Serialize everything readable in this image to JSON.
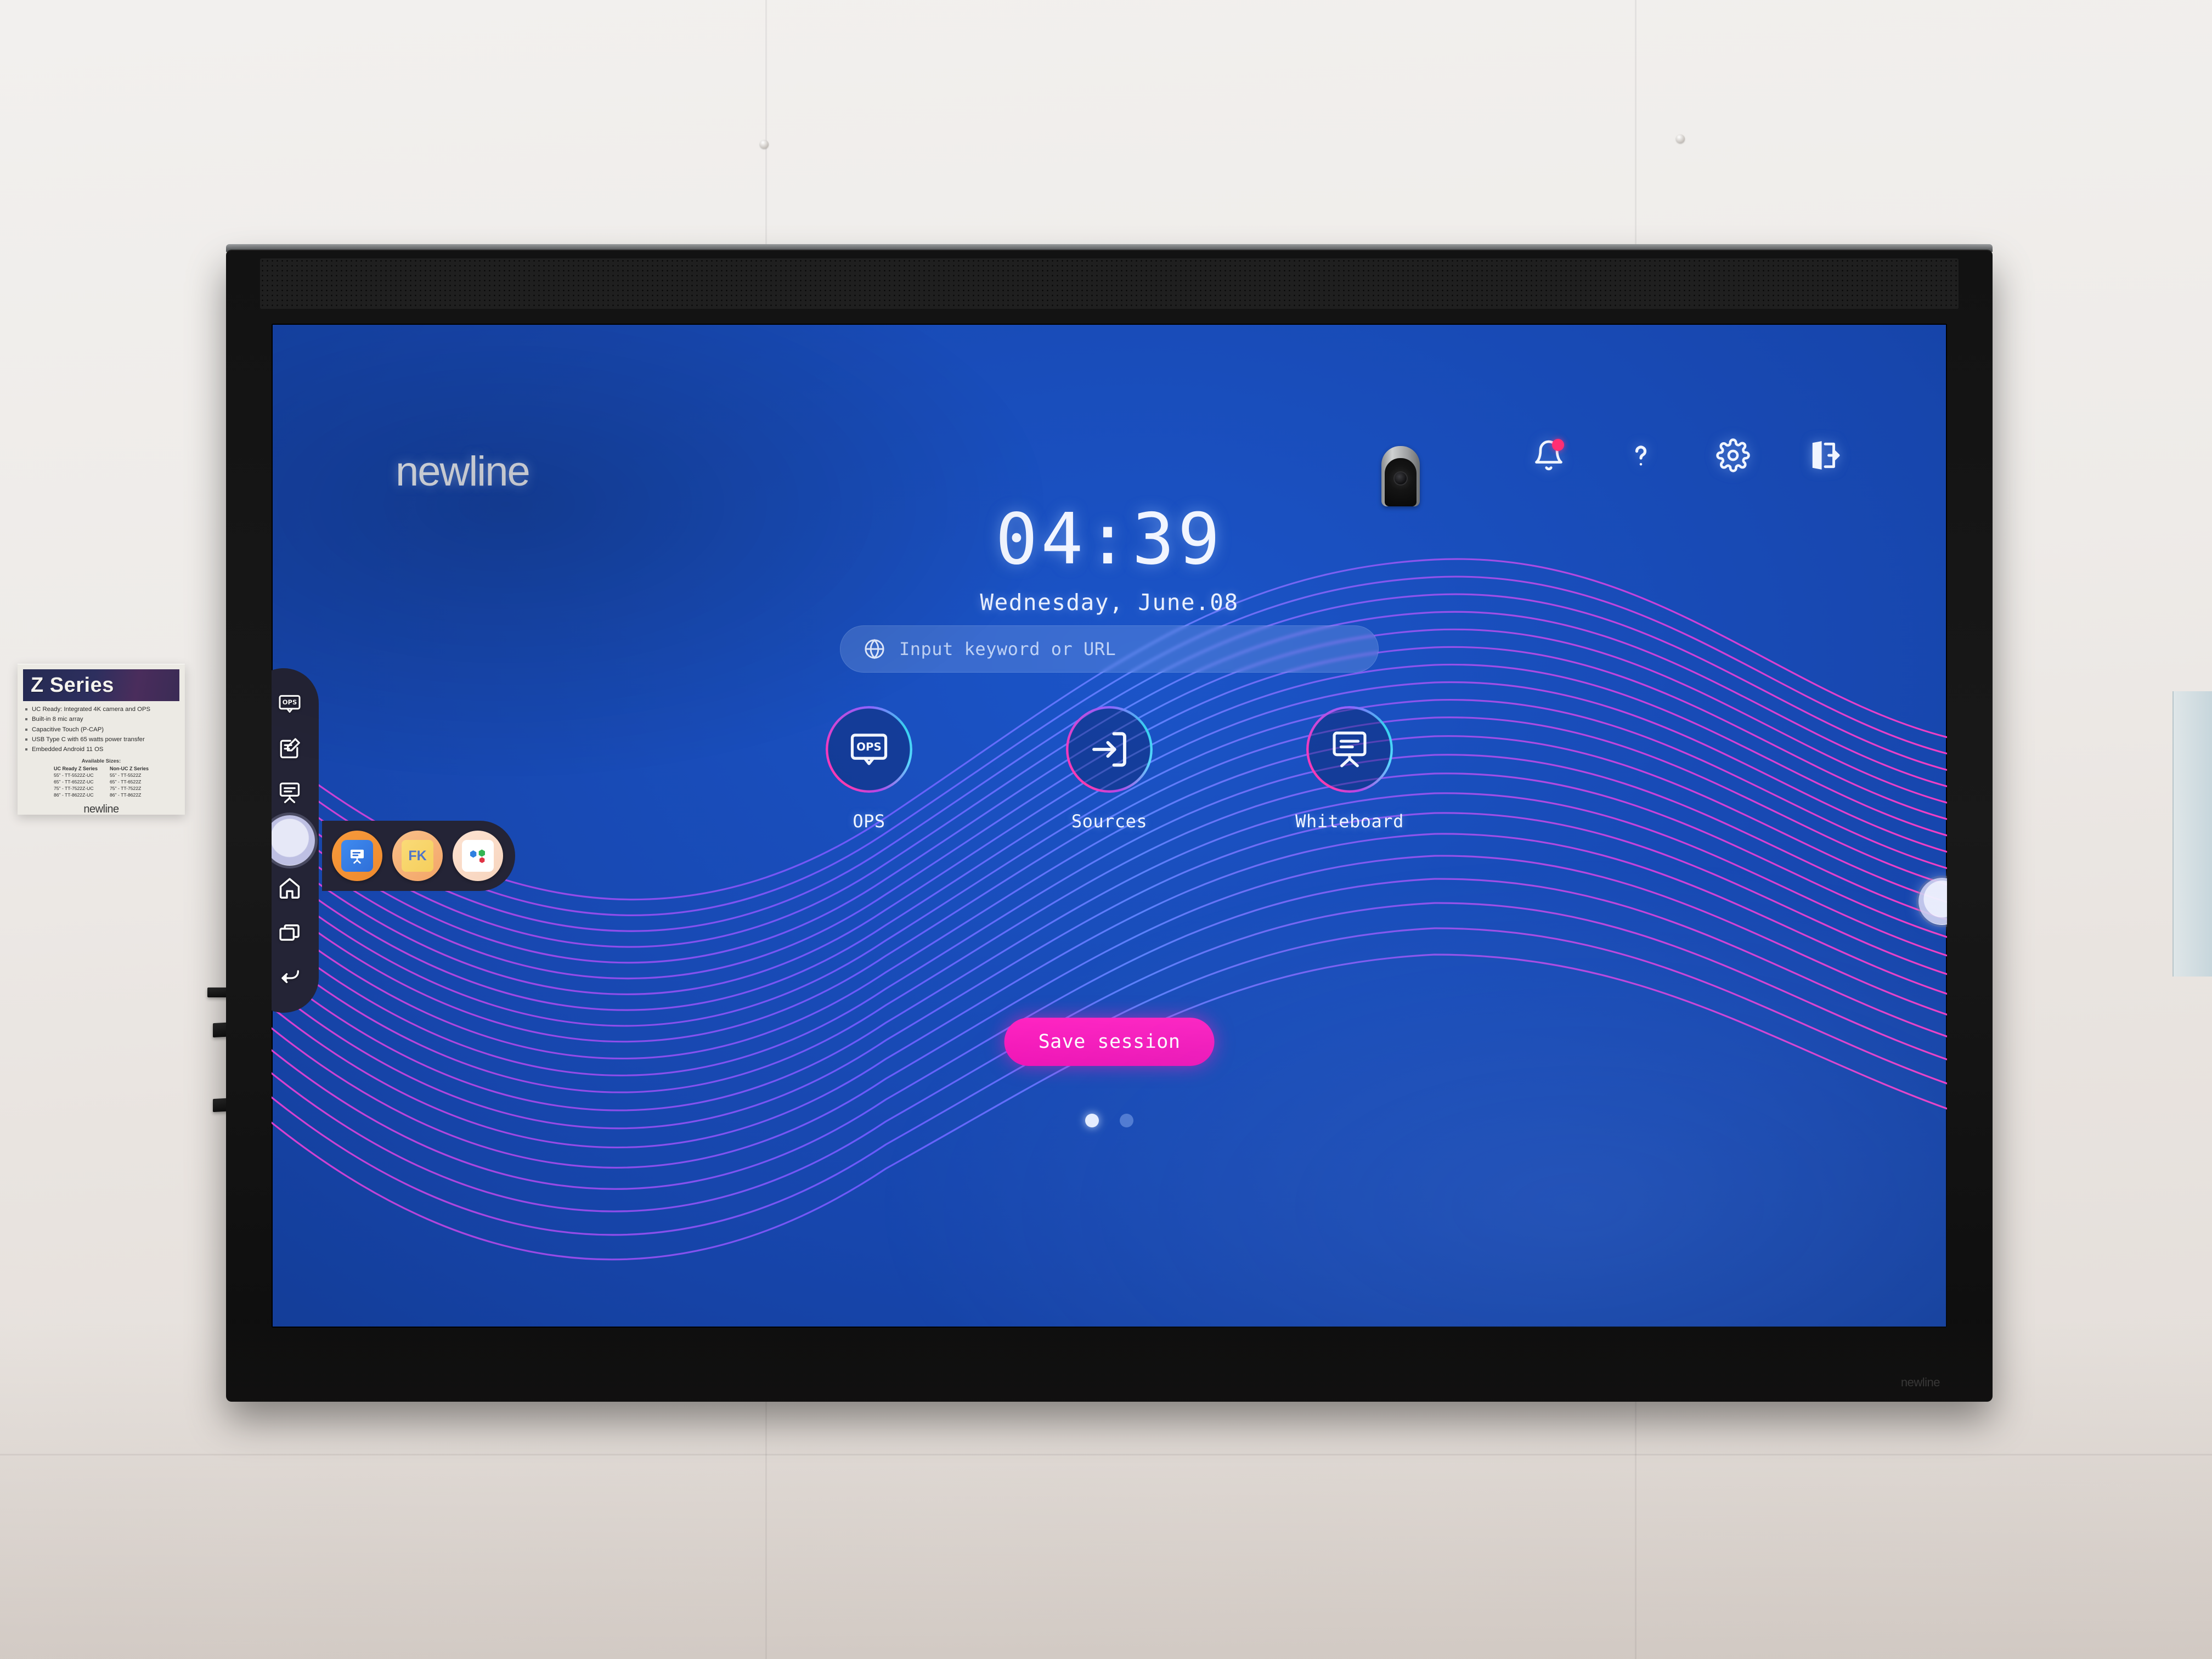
{
  "scene": {
    "description": "newline Z Series interactive flat panel display mounted on a showroom wall"
  },
  "wall_sign": {
    "title": "Z Series",
    "bullets": [
      "UC Ready: Integrated 4K camera and OPS",
      "Built-in 8 mic array",
      "Capacitive Touch (P-CAP)",
      "USB Type C with 65 watts power transfer",
      "Embedded Android 11 OS"
    ],
    "available_sizes_label": "Available Sizes:",
    "columns": [
      {
        "header": "UC Ready Z Series",
        "rows": [
          "55\" - TT-5522Z-UC",
          "65\" - TT-6522Z-UC",
          "75\" - TT-7522Z-UC",
          "86\" - TT-8622Z-UC"
        ]
      },
      {
        "header": "Non-UC Z Series",
        "rows": [
          "55\" - TT-5522Z",
          "65\" - TT-6522Z",
          "75\" - TT-7522Z",
          "86\" - TT-8622Z"
        ]
      }
    ],
    "brand": "newline"
  },
  "hardware": {
    "bezel_brand": "newline",
    "camera_label": "4k-camera-module"
  },
  "screen": {
    "logo": "newline",
    "topbar": [
      {
        "name": "notifications-button",
        "icon": "bell-icon",
        "badge": true
      },
      {
        "name": "help-button",
        "icon": "question-mark-icon",
        "badge": false
      },
      {
        "name": "settings-button",
        "icon": "gear-icon",
        "badge": false
      },
      {
        "name": "exit-button",
        "icon": "exit-door-icon",
        "badge": false
      }
    ],
    "clock": {
      "time": "04:39",
      "date": "Wednesday, June.08"
    },
    "search": {
      "icon": "globe-icon",
      "placeholder": "Input keyword or URL",
      "value": ""
    },
    "apps": [
      {
        "label": "OPS",
        "icon": "ops-monitor-icon"
      },
      {
        "label": "Sources",
        "icon": "input-source-arrow-icon"
      },
      {
        "label": "Whiteboard",
        "icon": "whiteboard-easel-icon"
      }
    ],
    "save_button": "Save session",
    "pagination": {
      "pages": 2,
      "active": 1
    },
    "colors": {
      "background_blue": "#1746ad",
      "accent_pink": "#ff24c2",
      "wave_violet": "#7b5cff",
      "wave_magenta": "#e13bd8",
      "badge_pink": "#ff2e73"
    }
  },
  "rail": {
    "items": [
      {
        "name": "rail-ops",
        "icon": "ops-monitor-icon"
      },
      {
        "name": "rail-annotate",
        "icon": "note-pencil-icon"
      },
      {
        "name": "rail-whiteboard",
        "icon": "whiteboard-easel-icon"
      },
      {
        "name": "rail-handle",
        "icon": "floating-ball-handle"
      },
      {
        "name": "rail-home",
        "icon": "home-icon"
      },
      {
        "name": "rail-recents",
        "icon": "multi-window-icon"
      },
      {
        "name": "rail-back",
        "icon": "back-arrow-icon"
      }
    ],
    "dock_apps": [
      {
        "name": "dock-whiteboard-app",
        "icon": "whiteboard-app-icon"
      },
      {
        "name": "dock-file-commander",
        "icon": "fk-folder-icon"
      },
      {
        "name": "dock-all-apps",
        "icon": "hexagon-apps-icon"
      }
    ],
    "side_handle": {
      "name": "right-floating-handle",
      "icon": "floating-ball-handle"
    }
  }
}
